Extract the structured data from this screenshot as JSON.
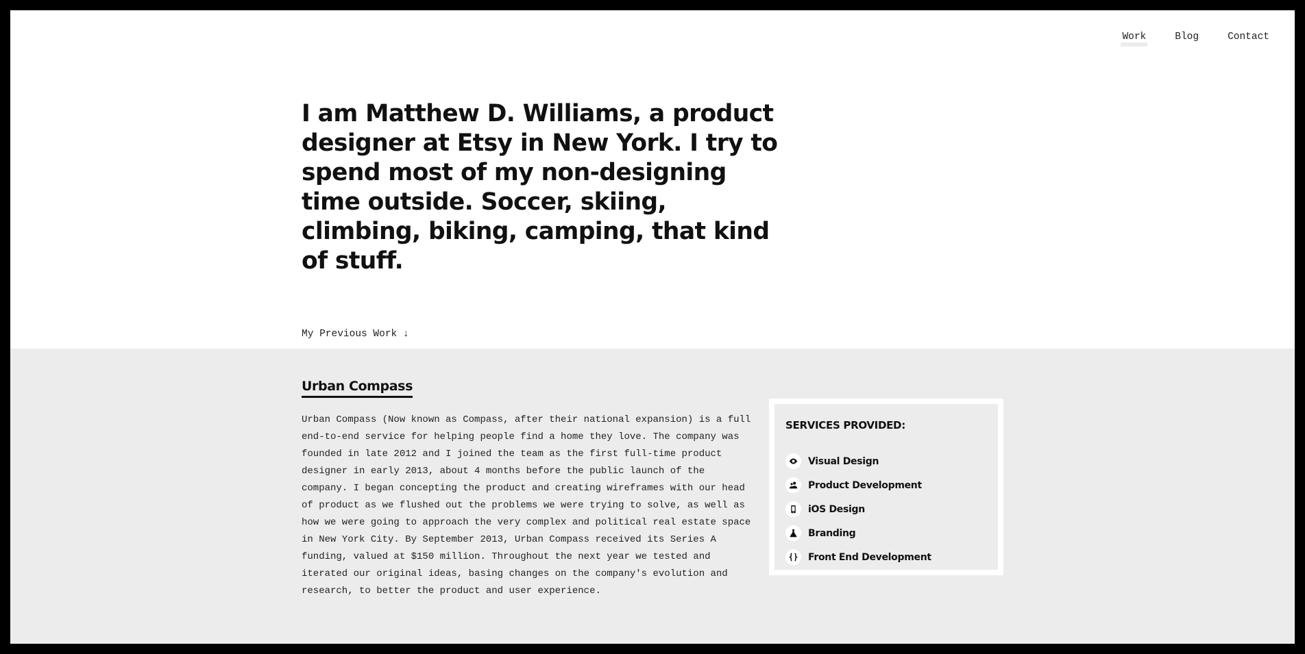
{
  "nav": {
    "items": [
      {
        "label": "Work",
        "active": true
      },
      {
        "label": "Blog",
        "active": false
      },
      {
        "label": "Contact",
        "active": false
      }
    ]
  },
  "hero": {
    "text": "I am Matthew D. Williams, a product designer at Etsy in New York. I try to spend most of my non-designing time outside. Soccer, skiing, climbing, biking, camping, that kind of stuff."
  },
  "previous_work_label": "My Previous Work ↓",
  "project": {
    "title": "Urban Compass",
    "description": "Urban Compass (Now known as Compass, after their national expansion) is a full end-to-end service for helping people find a home they love. The company was founded in late 2012 and I joined the team as the first full-time product designer in early 2013, about 4 months before the public launch of the company. I began concepting the product and creating wireframes with our head of product as we flushed out the problems we were trying to solve, as well as how we were going to approach the very complex and political real estate space in New York City. By September 2013, Urban Compass received its Series A funding, valued at $150 million. Throughout the next year we tested and iterated our original ideas, basing changes on the company's evolution and research, to better the product and user experience."
  },
  "services": {
    "title": "SERVICES PROVIDED:",
    "items": [
      {
        "label": "Visual Design",
        "icon": "eye-icon"
      },
      {
        "label": "Product Development",
        "icon": "users-icon"
      },
      {
        "label": "iOS Design",
        "icon": "mobile-icon"
      },
      {
        "label": "Branding",
        "icon": "flask-icon"
      },
      {
        "label": "Front End Development",
        "icon": "code-braces-icon"
      }
    ]
  },
  "colors": {
    "background": "#ffffff",
    "section_gray": "#ececec",
    "text": "#111111",
    "frame": "#000000"
  }
}
